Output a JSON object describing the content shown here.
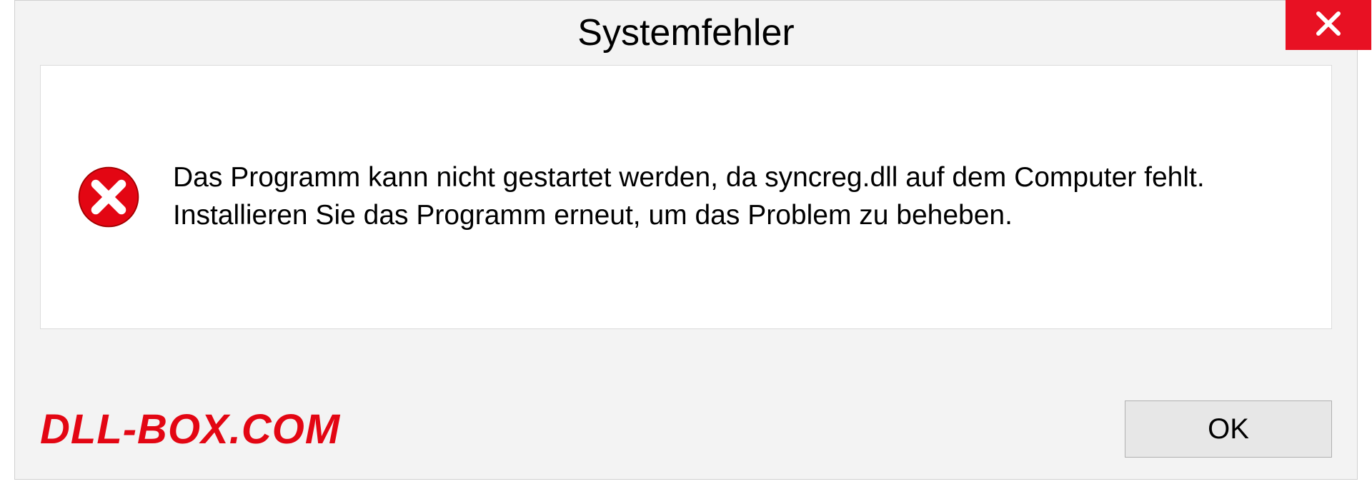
{
  "dialog": {
    "title": "Systemfehler",
    "message": "Das Programm kann nicht gestartet werden, da syncreg.dll auf dem Computer fehlt. Installieren Sie das Programm erneut, um das Problem zu beheben.",
    "ok_label": "OK"
  },
  "watermark": "DLL-BOX.COM"
}
